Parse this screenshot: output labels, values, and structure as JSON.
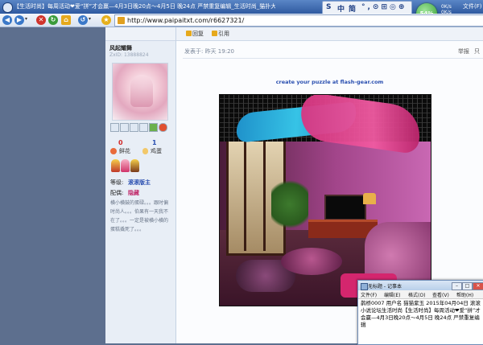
{
  "window": {
    "title": "【生活时尚】每周活动❤爱“拼”才会赢—4月3日晚20点～4月5日 晚24点 严禁重复编辑_生活时尚_猫扑大杂烩论坛",
    "doc_tab": "文件(F)"
  },
  "ime": {
    "lang": "中",
    "mode": "简",
    "icons": "°,⊙⊞◎⊕"
  },
  "speed": {
    "percent": "54%",
    "up": "0K/s",
    "down": "0K/s"
  },
  "toolbar": {
    "address": "http://www.paipaitxt.com/r6627321/"
  },
  "profile": {
    "actions_label": "",
    "username": "风起耀舞",
    "user_sub": "ZxID: 13888824",
    "flowers_value": "0",
    "flowers_label": "鲜花",
    "eggs_value": "1",
    "eggs_label": "鸡蛋",
    "level_label": "等级:",
    "level_value": "滚滚版主",
    "partner_label": "配偶:",
    "partner_value": "隐藏",
    "signature": "横小横鼓的蛋碌。。。跟时偏时尚人。。。伯果有一天我不在了。。。一定是被横小横的蛋糕撬死了。。。"
  },
  "post": {
    "reply_label": "回复",
    "quote_label": "引用",
    "time": "发表于: 昨天 19:20",
    "report": "举报",
    "print": "只",
    "puzzle_caption": "create your puzzle at flash-gear.com"
  },
  "notepad": {
    "title": "无标题 - 记事本",
    "menus": [
      "文件(F)",
      "编辑(E)",
      "格式(O)",
      "查看(V)",
      "帮助(H)"
    ],
    "text": "鹊桥0007 用户名 猫猫紫玉 2015年04月04日 滚滚小说论坛生活时尚【生活时尚】每周活动❤爱“拼”才会赢—4月3日晚20点～4月5日 晚24点 严禁重复编辑"
  }
}
